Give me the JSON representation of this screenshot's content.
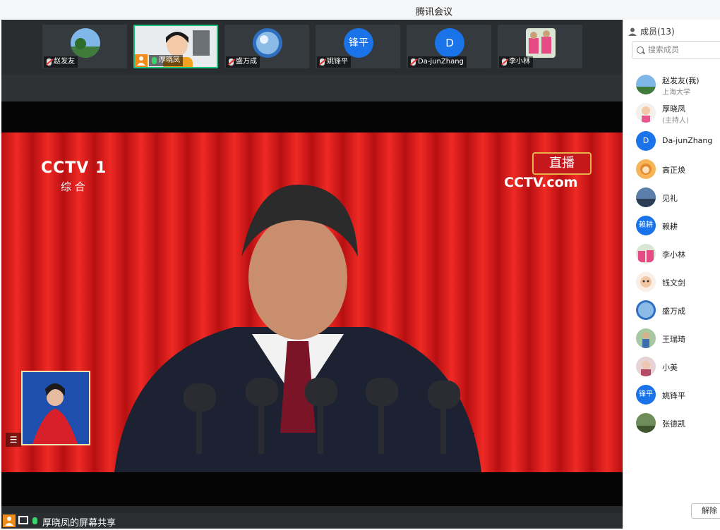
{
  "window": {
    "title": "腾讯会议"
  },
  "participant_strip": [
    {
      "name": "赵发友",
      "muted": true
    },
    {
      "name": "厚晓凤",
      "muted": false,
      "active": true
    },
    {
      "name": "盛万成",
      "muted": true
    },
    {
      "name": "姚锋平",
      "muted": true,
      "initials": "锋平"
    },
    {
      "name": "Da-junZhang",
      "muted": true,
      "initials": "D"
    },
    {
      "name": "李小林",
      "muted": true
    }
  ],
  "video": {
    "channel_logo": "CCTV 1",
    "channel_sub": "综 合",
    "live_badge": "直播",
    "site_logo": "CCTV.com"
  },
  "share_bar": {
    "label": "厚晓凤的屏幕共享"
  },
  "members_panel": {
    "header": "成员(13)",
    "search_placeholder": "搜索成员",
    "members": [
      {
        "name": "赵发友(我)",
        "subtitle": "上海大学"
      },
      {
        "name": "厚晓凤",
        "subtitle": "(主持人)"
      },
      {
        "name": "Da-junZhang",
        "initials": "D"
      },
      {
        "name": "高正焕"
      },
      {
        "name": "见礼"
      },
      {
        "name": "赖耕",
        "initials": "赖耕"
      },
      {
        "name": "李小林"
      },
      {
        "name": "钱文剑"
      },
      {
        "name": "盛万成"
      },
      {
        "name": "王瑞琦"
      },
      {
        "name": "小美"
      },
      {
        "name": "姚锋平",
        "initials": "锋平"
      },
      {
        "name": "张德凯"
      }
    ],
    "unmute_button": "解除"
  },
  "colors": {
    "accent_blue": "#1a73e8",
    "broadcast_red": "#d8191c",
    "active_green": "#19c37d",
    "host_orange": "#f08c1a"
  }
}
